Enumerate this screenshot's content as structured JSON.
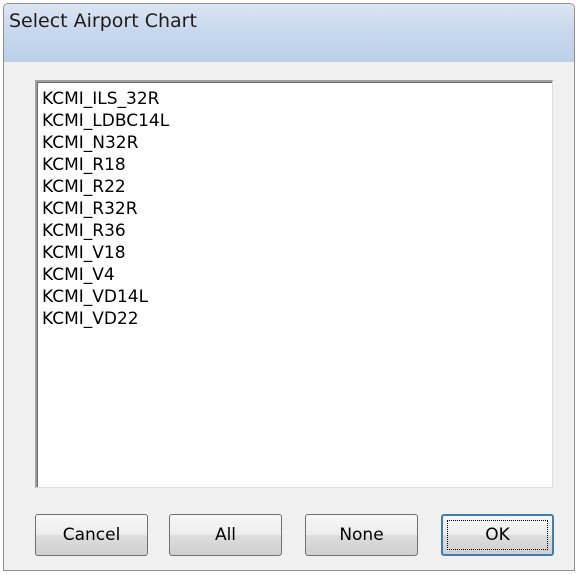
{
  "window": {
    "title": "Select Airport Chart"
  },
  "chart_list": {
    "items": [
      "KCMI_ILS_32R",
      "KCMI_LDBC14L",
      "KCMI_N32R",
      "KCMI_R18",
      "KCMI_R22",
      "KCMI_R32R",
      "KCMI_R36",
      "KCMI_V18",
      "KCMI_V4",
      "KCMI_VD14L",
      "KCMI_VD22"
    ]
  },
  "buttons": {
    "cancel_label": "Cancel",
    "all_label": "All",
    "none_label": "None",
    "ok_label": "OK"
  },
  "colors": {
    "titlebar": "#c9d8ec",
    "dialog_background": "#f0f0f0",
    "default_button_border": "#3c7fb1"
  }
}
